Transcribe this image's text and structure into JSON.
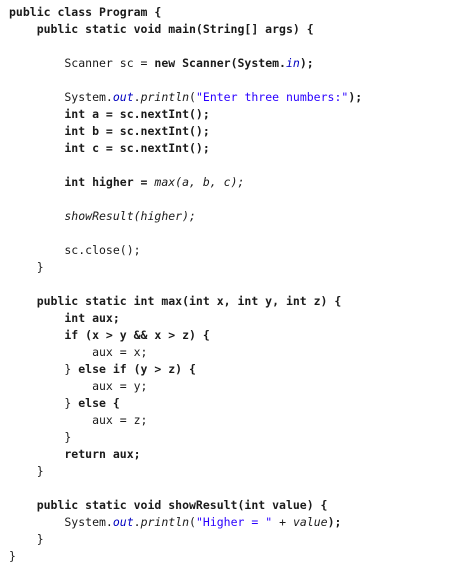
{
  "editor": {
    "lines": [
      [
        {
          "t": "public class Program {",
          "c": "bo"
        }
      ],
      [
        {
          "t": "    public static void main(String[] args) {",
          "c": "bo"
        }
      ],
      [
        {
          "t": "",
          "c": "pl"
        }
      ],
      [
        {
          "t": "        Scanner sc = ",
          "c": "pl"
        },
        {
          "t": "new",
          "c": "bo"
        },
        {
          "t": " ",
          "c": "pl"
        },
        {
          "t": "Scanner(System.",
          "c": "bo"
        },
        {
          "t": "in",
          "c": "fi"
        },
        {
          "t": ");",
          "c": "bo"
        }
      ],
      [
        {
          "t": "",
          "c": "pl"
        }
      ],
      [
        {
          "t": "        System.",
          "c": "pl"
        },
        {
          "t": "out",
          "c": "fi"
        },
        {
          "t": ".",
          "c": "pl"
        },
        {
          "t": "println",
          "c": "it"
        },
        {
          "t": "(",
          "c": "pl"
        },
        {
          "t": "\"Enter three numbers:\"",
          "c": "st"
        },
        {
          "t": ");",
          "c": "bo"
        }
      ],
      [
        {
          "t": "        int a = sc.nextInt();",
          "c": "bo"
        }
      ],
      [
        {
          "t": "        int b = sc.nextInt();",
          "c": "bo"
        }
      ],
      [
        {
          "t": "        int c = sc.nextInt();",
          "c": "bo"
        }
      ],
      [
        {
          "t": "",
          "c": "pl"
        }
      ],
      [
        {
          "t": "        int higher = ",
          "c": "bo"
        },
        {
          "t": "max(a, b, c);",
          "c": "it"
        }
      ],
      [
        {
          "t": "",
          "c": "pl"
        }
      ],
      [
        {
          "t": "        showResult(higher);",
          "c": "it"
        }
      ],
      [
        {
          "t": "",
          "c": "pl"
        }
      ],
      [
        {
          "t": "        sc.close();",
          "c": "pl"
        }
      ],
      [
        {
          "t": "    }",
          "c": "pl"
        }
      ],
      [
        {
          "t": "",
          "c": "pl"
        }
      ],
      [
        {
          "t": "    public static int max(int x, int y, int z) {",
          "c": "bo"
        }
      ],
      [
        {
          "t": "        int aux;",
          "c": "bo"
        }
      ],
      [
        {
          "t": "        if (x > y && x > z) {",
          "c": "bo"
        }
      ],
      [
        {
          "t": "            aux = x;",
          "c": "pl"
        }
      ],
      [
        {
          "t": "        } ",
          "c": "pl"
        },
        {
          "t": "else if (y > z) {",
          "c": "bo"
        }
      ],
      [
        {
          "t": "            aux = y;",
          "c": "pl"
        }
      ],
      [
        {
          "t": "        } ",
          "c": "pl"
        },
        {
          "t": "else {",
          "c": "bo"
        }
      ],
      [
        {
          "t": "            aux = z;",
          "c": "pl"
        }
      ],
      [
        {
          "t": "        }",
          "c": "pl"
        }
      ],
      [
        {
          "t": "        return aux;",
          "c": "bo"
        }
      ],
      [
        {
          "t": "    }",
          "c": "pl"
        }
      ],
      [
        {
          "t": "",
          "c": "pl"
        }
      ],
      [
        {
          "t": "    public static void showResult(int value) {",
          "c": "bo"
        }
      ],
      [
        {
          "t": "        System.",
          "c": "pl"
        },
        {
          "t": "out",
          "c": "fi"
        },
        {
          "t": ".",
          "c": "pl"
        },
        {
          "t": "println",
          "c": "it"
        },
        {
          "t": "(",
          "c": "pl"
        },
        {
          "t": "\"Higher = \"",
          "c": "st"
        },
        {
          "t": " + ",
          "c": "pl"
        },
        {
          "t": "value",
          "c": "it"
        },
        {
          "t": ");",
          "c": "bo"
        }
      ],
      [
        {
          "t": "    }",
          "c": "pl"
        }
      ],
      [
        {
          "t": "}",
          "c": "pl"
        }
      ]
    ]
  }
}
